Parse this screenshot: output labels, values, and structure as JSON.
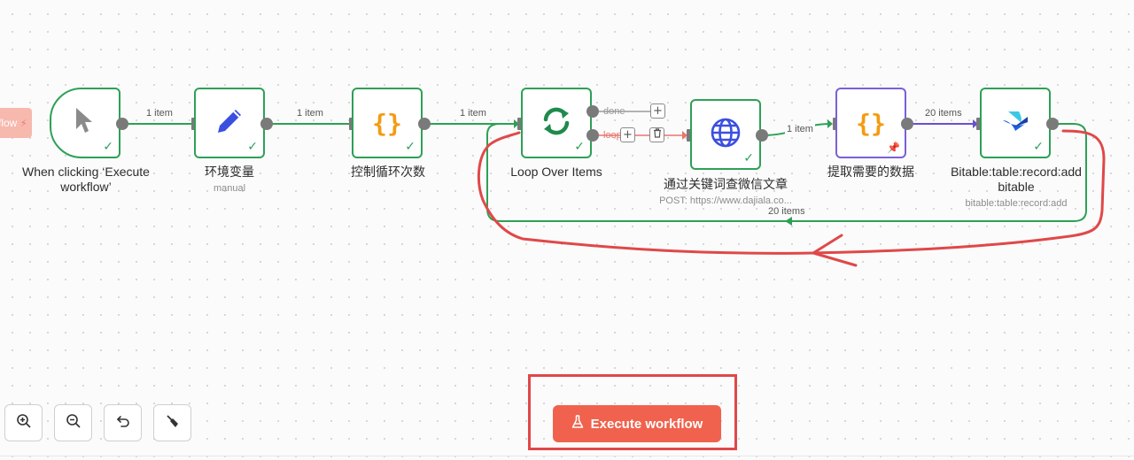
{
  "colors": {
    "success": "#2ea056",
    "accent": "#f0624d",
    "annotation": "#e04848",
    "code_node": "#7c5fd6",
    "pencil": "#3a4fe0",
    "globe": "#3a4fe0",
    "braces": "#f39c12"
  },
  "side_tag": {
    "text": "flow"
  },
  "nodes": [
    {
      "id": "trigger",
      "icon": "cursor-icon",
      "label": "When clicking ‘Execute workflow’",
      "status": "success"
    },
    {
      "id": "env",
      "icon": "pencil-icon",
      "label": "环境变量",
      "sublabel": "manual",
      "status": "success"
    },
    {
      "id": "loopcount",
      "icon": "braces-icon",
      "label": "控制循环次数",
      "status": "success"
    },
    {
      "id": "loop",
      "icon": "refresh-icon",
      "label": "Loop Over Items",
      "status": "success"
    },
    {
      "id": "search",
      "icon": "globe-icon",
      "label": "通过关键词查微信文章",
      "sublabel": "POST: https://www.dajiala.co...",
      "status": "success"
    },
    {
      "id": "extract",
      "icon": "braces-icon",
      "label": "提取需要的数据",
      "status": "pinned"
    },
    {
      "id": "bitable",
      "icon": "bitable-icon",
      "label": "Bitable:table:record:add bitable",
      "sublabel": "bitable:table:record:add",
      "status": "success"
    }
  ],
  "edges": {
    "trigger_env": "1 item",
    "env_loopcount": "1 item",
    "loopcount_loop": "1 item",
    "loop_done": "done",
    "loop_loop": "loop",
    "search_extract": "1 item",
    "extract_bitable": "20 items",
    "bitable_back": "20 items"
  },
  "toolbar": {
    "zoom_in": "zoom-in-icon",
    "zoom_out": "zoom-out-icon",
    "undo": "undo-icon",
    "tidy": "broom-icon"
  },
  "execute_button": {
    "label": "Execute workflow",
    "icon": "flask-icon"
  }
}
